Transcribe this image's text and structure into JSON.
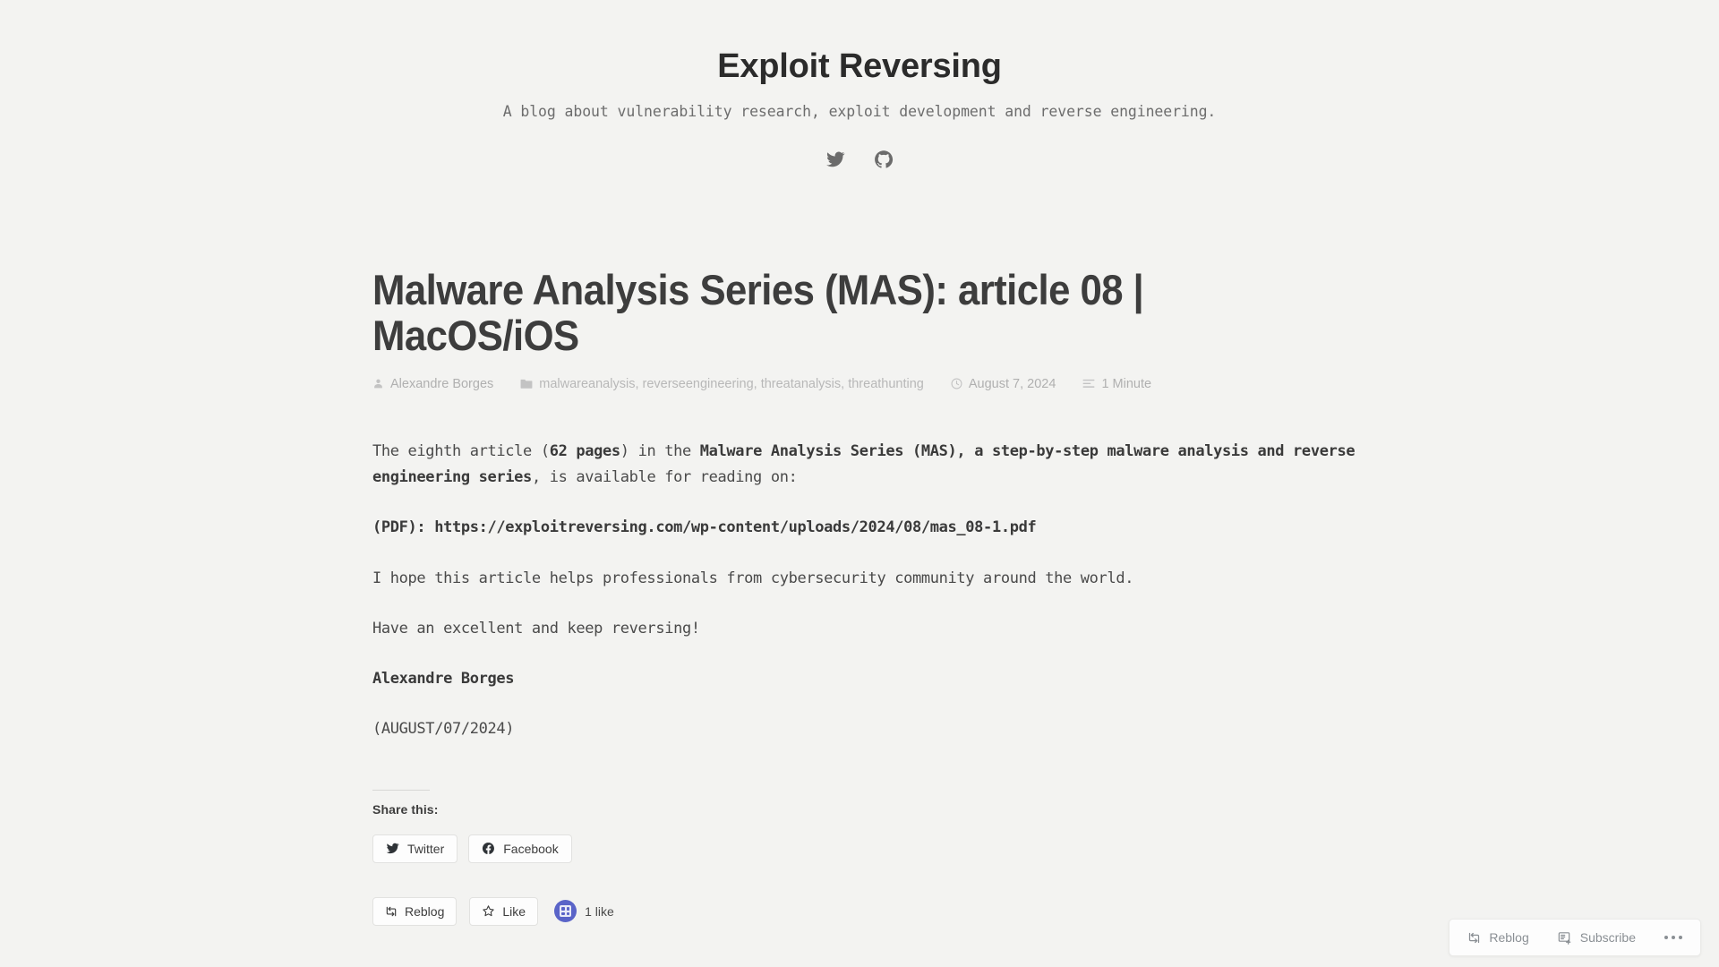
{
  "site": {
    "title": "Exploit Reversing",
    "tagline": "A blog about vulnerability research, exploit development and reverse engineering.",
    "social": [
      {
        "name": "twitter-icon",
        "label": "Twitter"
      },
      {
        "name": "github-icon",
        "label": "GitHub"
      }
    ]
  },
  "post": {
    "title": "Malware Analysis Series (MAS): article 08 | MacOS/iOS",
    "meta": {
      "author": "Alexandre Borges",
      "categories": "malwareanalysis, reverseengineering, threatanalysis, threathunting",
      "date": "August 7, 2024",
      "reading_time": "1 Minute"
    },
    "paragraph_1": {
      "part_1": "The eighth article (",
      "bold_1": "62 pages",
      "part_2": ") in the ",
      "bold_2": "Malware Analysis Series (MAS), a step-by-step malware analysis and reverse engineering series",
      "part_3": ", is available for reading on:"
    },
    "pdf_line": "(PDF): https://exploitreversing.com/wp-content/uploads/2024/08/mas_08-1.pdf",
    "paragraph_2": "I hope this article helps professionals from cybersecurity community around the world.",
    "paragraph_3": "Have an excellent and keep reversing!",
    "signature": "Alexandre Borges",
    "signature_date": "(AUGUST/07/2024)"
  },
  "share": {
    "title": "Share this:",
    "buttons": [
      {
        "name": "share-twitter-button",
        "label": "Twitter",
        "icon": "twitter-icon"
      },
      {
        "name": "share-facebook-button",
        "label": "Facebook",
        "icon": "facebook-icon"
      }
    ]
  },
  "actions": {
    "reblog_label": "Reblog",
    "like_label": "Like",
    "like_count": "1 like"
  },
  "wp_bar": {
    "reblog_label": "Reblog",
    "subscribe_label": "Subscribe",
    "more_label": "More options"
  },
  "colors": {
    "background": "#f3f3f1",
    "title": "#3d3d3d",
    "body_text": "#4a4a4a",
    "meta_text": "#b0b0b0",
    "avatar_blue": "#5a64c8",
    "wp_bar_text": "#8a8f94"
  }
}
